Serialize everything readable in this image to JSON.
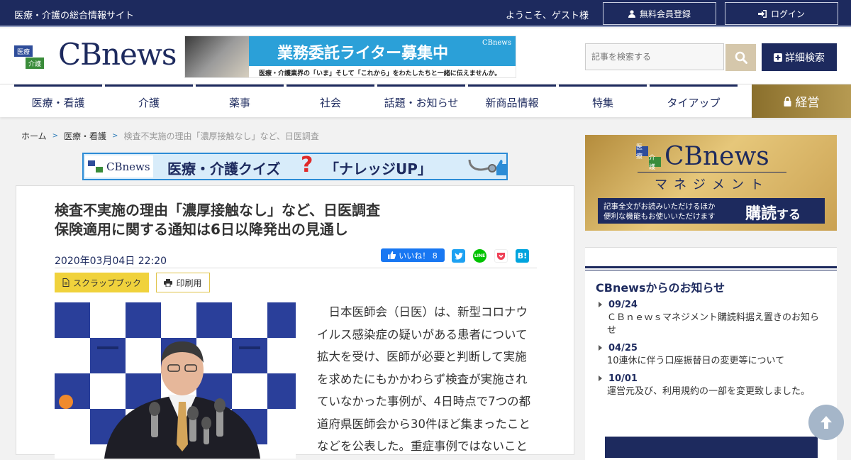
{
  "topbar": {
    "tagline": "医療・介護の総合情報サイト",
    "welcome": "ようこそ、ゲスト様",
    "register_label": "無料会員登録",
    "login_label": "ログイン"
  },
  "header": {
    "logo_badge": [
      "医療",
      "介護"
    ],
    "logo_text": "CBnews",
    "banner": {
      "headline": "業務委託ライター募集中",
      "brand": "CBnews",
      "subline": "医療・介護業界の「いま」そして「これから」をわたしたちと一緒に伝えませんか。"
    },
    "search_placeholder": "記事を検索する",
    "advanced_search_label": "詳細検索"
  },
  "nav": {
    "items": [
      "医療・看護",
      "介護",
      "薬事",
      "社会",
      "話題・お知らせ",
      "新商品情報",
      "特集",
      "タイアップ"
    ],
    "keiei_label": "経営"
  },
  "breadcrumb": [
    "ホーム",
    "医療・看護",
    "検査不実施の理由「濃厚接触なし」など、日医調査"
  ],
  "quiz_banner": {
    "logo": "CBnews",
    "title": "医療・介護クイズ",
    "subtitle": "「ナレッジUP」"
  },
  "article": {
    "title_line1": "検査不実施の理由「濃厚接触なし」など、日医調査",
    "title_line2": "保険適用に関する通知は6日以降発出の見通し",
    "date": "2020年03月04日 22:20",
    "like_label": "いいね！ 8",
    "share_labels": {
      "line": "LINE",
      "hatena": "B!"
    },
    "scrapbook_label": "スクラップブック",
    "print_label": "印刷用",
    "body": "日本医師会（日医）は、新型コロナウイルス感染症の疑いがある患者について拡大を受け、医師が必要と判断して実施を求めたにもかかわらず検査が実施されていなかった事例が、4日時点で7つの都道府県医師会から30件ほど集まったことなどを公表した。重症事例ではないこと"
  },
  "sidebar": {
    "management": {
      "badge": [
        "医療",
        "介護"
      ],
      "logo": "CBnews",
      "subtitle": "マネジメント",
      "line1": "記事全文がお読みいただけるほか",
      "line2": "便利な機能もお使いいただけます",
      "buy": "購読",
      "buy_suffix": "する"
    },
    "notice": {
      "title": "CBnewsからのお知らせ",
      "items": [
        {
          "date": "09/24",
          "text": "ＣＢｎｅｗｓマネジメント購読料据え置きのお知らせ"
        },
        {
          "date": "04/25",
          "text": "10連休に伴う口座振替日の変更等について"
        },
        {
          "date": "10/01",
          "text": "運営元及び、利用規約の一部を変更致しました。"
        }
      ]
    }
  },
  "colors": {
    "navy": "#1d2a5e",
    "gold": "#b69a52",
    "badge_blue": "#2f4d9a",
    "badge_green": "#3a8c3a",
    "badge_orange": "#d97a1d",
    "badge_red": "#c0392b"
  }
}
